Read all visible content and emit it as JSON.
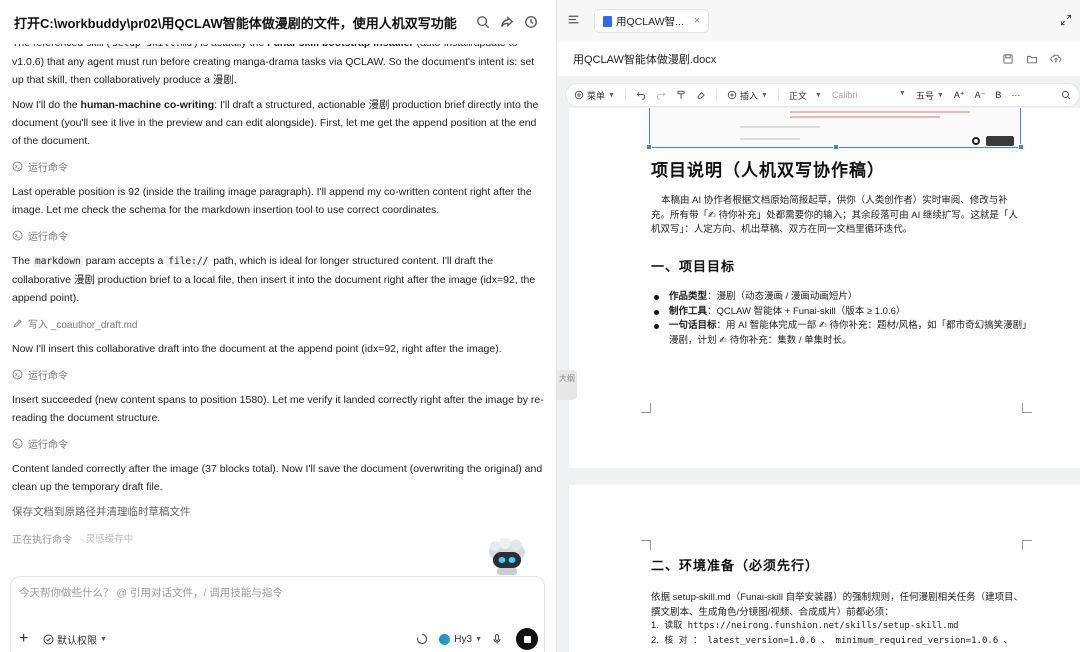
{
  "chat": {
    "title": "打开C:\\workbuddy\\pr02\\用QCLAW智能体做漫剧的文件，使用人机双写功能",
    "header_icons": [
      "search-icon",
      "share-icon",
      "history-icon"
    ],
    "messages": {
      "m0_a": "The referenced skill (",
      "m0_code": "setup-skill.md",
      "m0_b": ") is actually the ",
      "m0_bold": "Funai-skill bootstrap installer",
      "m0_c": " (auto-install/update to v1.0.6) that any agent must run before creating manga-drama tasks via QCLAW. So the document's intent is: set up that skill, then collaboratively produce a 漫剧.",
      "m1_a": "Now I'll do the ",
      "m1_bold": "human-machine co-writing",
      "m1_b": ": I'll draft a structured, actionable 漫剧 production brief directly into the document (you'll see it live in the preview and can edit alongside). First, let me get the append position at the end of the document.",
      "t1": "运行命令",
      "m2": "Last operable position is 92 (inside the trailing image paragraph). I'll append my co-written content right after the image. Let me check the schema for the markdown insertion tool to use correct coordinates.",
      "t2": "运行命令",
      "m3_a": "The ",
      "m3_code1": "markdown",
      "m3_b": " param accepts a ",
      "m3_code2": "file://",
      "m3_c": " path, which is ideal for longer structured content. I'll draft the collaborative 漫剧 production brief to a local file, then insert it into the document right after the image (idx=92, the append point).",
      "t3": "写入 _coauthor_draft.md",
      "m4": "Now I'll insert this collaborative draft into the document at the append point (idx=92, right after the image).",
      "t4": "运行命令",
      "m5": "Insert succeeded (new content spans to position 1580). Let me verify it landed correctly right after the image by re-reading the document structure.",
      "t5": "运行命令",
      "m6": "Content landed correctly after the image (37 blocks total). Now I'll save the document (overwriting the original) and clean up the temporary draft file.",
      "status": "保存文档到原路径并清理临时草稿文件",
      "running": "正在执行命令",
      "running_sub": "· 灵感缓存中"
    },
    "composer": {
      "placeholder": "今天帮你做些什么？ @ 引用对话文件，/ 调用技能与指令",
      "add_label": "+",
      "permission_label": "默认权限",
      "model_label": "Hy3"
    }
  },
  "doc": {
    "tab_label": "用QCLAW智...",
    "tab_close": "×",
    "filename": "用QCLAW智能体做漫剧.docx",
    "toolbar": {
      "menu": "菜单",
      "insert": "插入",
      "style": "正文",
      "font": "Calibri",
      "size": "五号",
      "grow": "A⁺",
      "shrink": "A⁻",
      "bold": "B",
      "more": "···"
    },
    "side_tab": "大纲",
    "page1": {
      "h1": "项目说明（人机双写协作稿）",
      "intro": "本稿由 AI 协作者根据文档原始简报起草，供你（人类创作者）实时审阅、修改与补充。所有带「✍ 待你补充」处都需要你的输入；其余段落可由 AI 继续扩写。这就是「人机双写」：人定方向、机出草稿、双方在同一文档里循环迭代。",
      "h2": "一、项目目标",
      "b1_label": "作品类型",
      "b1_text": "：漫剧（动态漫画 / 漫画动画短片）",
      "b2_label": "制作工具",
      "b2_text": "：QCLAW 智能体 + Funai-skill（版本 ≥ 1.0.6）",
      "b3_label": "一句话目标",
      "b3_text": "：用 AI 智能体完成一部 ✍ 待你补充：题材/风格，如「都市奇幻搞笑漫剧」 漫剧，计划 ✍ 待你补充：集数 / 单集时长。"
    },
    "page2": {
      "h2": "二、环境准备（必须先行）",
      "p1": "依据 setup-skill.md（Funai-skill 自举安装器）的强制规则，任何漫剧相关任务（建项目、撰文剧本、生成角色/分镜图/视频、合成成片）前都必须：",
      "l1_num": "1.",
      "l1_text": "读取 https://neirong.funshion.net/skills/setup-skill.md",
      "l2_num": "2.",
      "l2_text": "核 对 ： latest_version=1.0.6 、 minimum_required_version=1.0.6 、"
    }
  }
}
